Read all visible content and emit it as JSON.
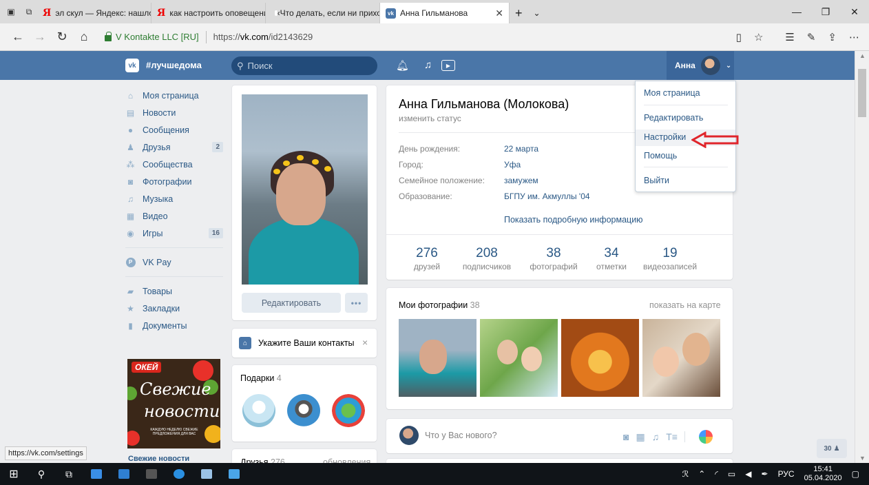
{
  "browser": {
    "tabs": [
      {
        "label": "эл скул — Яндекс: нашлось",
        "favicon": "yandex-icon"
      },
      {
        "label": "как настроить оповещения",
        "favicon": "yandex-icon"
      },
      {
        "label": "«Что делать, если ни прихо",
        "favicon": "zen-icon"
      },
      {
        "label": "Анна Гильманова",
        "favicon": "vk-icon",
        "active": true
      }
    ],
    "cert_name": "V Kontakte LLC [RU]",
    "url_prefix": "https://",
    "url_host": "vk.com",
    "url_path": "/id2143629",
    "status_url": "https://vk.com/settings"
  },
  "vk": {
    "logo": "vk",
    "hashtag": "#лучшедома",
    "search_placeholder": "Поиск",
    "user_short": "Анна",
    "left_menu": [
      {
        "label": "Моя страница",
        "icon": "home-icon"
      },
      {
        "label": "Новости",
        "icon": "news-icon"
      },
      {
        "label": "Сообщения",
        "icon": "messages-icon"
      },
      {
        "label": "Друзья",
        "icon": "friends-icon",
        "count": "2"
      },
      {
        "label": "Сообщества",
        "icon": "groups-icon"
      },
      {
        "label": "Фотографии",
        "icon": "camera-icon"
      },
      {
        "label": "Музыка",
        "icon": "music-icon"
      },
      {
        "label": "Видео",
        "icon": "video-icon"
      },
      {
        "label": "Игры",
        "icon": "games-icon",
        "count": "16"
      }
    ],
    "vkpay_label": "VK Pay",
    "vkpay_icon_text": "P",
    "left_menu_extra": [
      {
        "label": "Товары",
        "icon": "bag-icon"
      },
      {
        "label": "Закладки",
        "icon": "star-icon"
      },
      {
        "label": "Документы",
        "icon": "document-icon"
      }
    ],
    "ad": {
      "logo": "ОКЕЙ",
      "line1": "Свежие",
      "line2": "новости",
      "small": "каждую неделю свежие предложения для вас",
      "caption": "Свежие новости"
    },
    "edit_button": "Редактировать",
    "more_button": "•••",
    "contacts_prompt": "Укажите Ваши контакты",
    "contacts_close": "×",
    "gifts_title": "Подарки",
    "gifts_count": "4",
    "friends_block_title": "Друзья",
    "friends_block_count": "276",
    "friends_block_link": "обновления",
    "profile": {
      "name": "Анна Гильманова (Молокова)",
      "status_link": "изменить статус",
      "info": [
        {
          "label": "День рождения:",
          "value": "22 марта"
        },
        {
          "label": "Город:",
          "value": "Уфа"
        },
        {
          "label": "Семейное положение:",
          "value": "замужем"
        },
        {
          "label": "Образование:",
          "value": "БГПУ им. Акмуллы '04"
        }
      ],
      "show_more": "Показать подробную информацию",
      "stats": [
        {
          "num": "276",
          "label": "друзей"
        },
        {
          "num": "208",
          "label": "подписчиков"
        },
        {
          "num": "38",
          "label": "фотографий"
        },
        {
          "num": "34",
          "label": "отметки"
        },
        {
          "num": "19",
          "label": "видеозаписей"
        }
      ]
    },
    "photos": {
      "title": "Мои фотографии",
      "count": "38",
      "map_link": "показать на карте"
    },
    "post_placeholder": "Что у Вас нового?",
    "post_format_icon_text": "T≡",
    "dropdown": [
      {
        "label": "Моя страница"
      },
      {
        "label": "Редактировать"
      },
      {
        "label": "Настройки"
      },
      {
        "label": "Помощь"
      },
      {
        "label": "Выйти"
      }
    ],
    "online_friends": "30"
  },
  "taskbar": {
    "lang": "РУС",
    "time": "15:41",
    "date": "05.04.2020"
  },
  "colors": {
    "vk_blue": "#4a76a8",
    "link": "#2a5885",
    "arrow": "#e0252b"
  }
}
